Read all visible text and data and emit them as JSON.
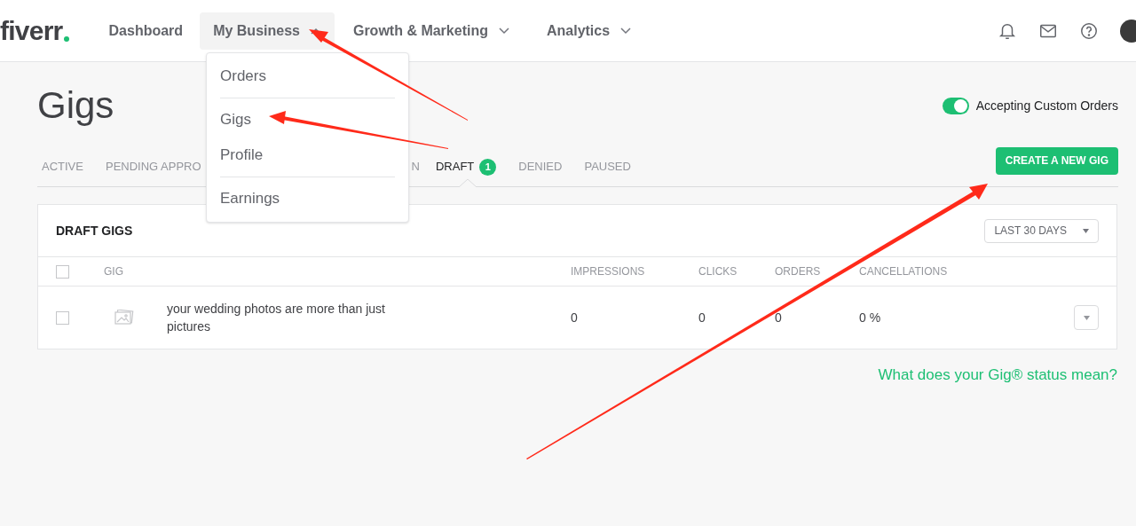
{
  "logo": {
    "text": "fiverr"
  },
  "nav": [
    {
      "label": "Dashboard"
    },
    {
      "label": "My Business",
      "expanded": true
    },
    {
      "label": "Growth & Marketing",
      "expanded": false
    },
    {
      "label": "Analytics",
      "expanded": false
    }
  ],
  "nav_menu": [
    {
      "label": "Orders",
      "divider_after": true
    },
    {
      "label": "Gigs",
      "divider_after": false
    },
    {
      "label": "Profile",
      "divider_after": true
    },
    {
      "label": "Earnings",
      "divider_after": false
    }
  ],
  "page_title": "Gigs",
  "custom_orders": {
    "label": "Accepting Custom Orders",
    "on": true
  },
  "tabs": [
    {
      "label": "ACTIVE",
      "selected": false
    },
    {
      "label": "PENDING APPRO",
      "selected": false
    },
    {
      "label": "N",
      "selected": false
    },
    {
      "label": "DRAFT",
      "selected": true,
      "count": "1"
    },
    {
      "label": "DENIED",
      "selected": false
    },
    {
      "label": "PAUSED",
      "selected": false
    }
  ],
  "create_button": "CREATE A NEW GIG",
  "table": {
    "title": "DRAFT GIGS",
    "period": "LAST 30 DAYS",
    "select_all_checked": false,
    "columns": [
      "GIG",
      "IMPRESSIONS",
      "CLICKS",
      "ORDERS",
      "CANCELLATIONS"
    ],
    "rows": [
      {
        "checked": false,
        "gig": "your wedding photos are more than just pictures",
        "impressions": "0",
        "clicks": "0",
        "orders": "0",
        "cancellations": "0 %"
      }
    ]
  },
  "help_link": "What does your Gig® status mean?"
}
